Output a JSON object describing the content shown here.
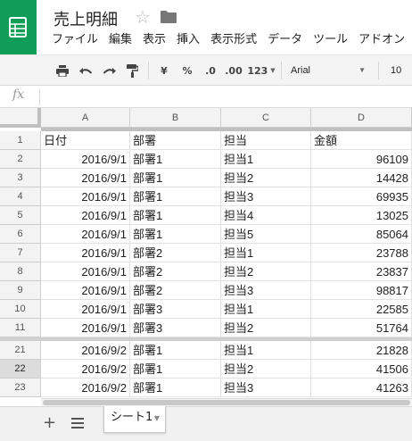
{
  "app": {
    "title": "売上明細",
    "menu": [
      "ファイル",
      "編集",
      "表示",
      "挿入",
      "表示形式",
      "データ",
      "ツール",
      "アドオン"
    ]
  },
  "toolbar": {
    "currency": "¥",
    "percent": "%",
    "decrease_decimal": ".0",
    "increase_decimal": ".00",
    "more_formats": "123",
    "font": "Arial",
    "font_size": "10"
  },
  "formula_bar": {
    "fx": "fx",
    "value": ""
  },
  "grid": {
    "columns": [
      "A",
      "B",
      "C",
      "D"
    ],
    "rows": [
      {
        "num": "1",
        "a": "日付",
        "b": "部署",
        "c": "担当",
        "d": "金額",
        "header": true
      },
      {
        "num": "2",
        "a": "2016/9/1",
        "b": "部署1",
        "c": "担当1",
        "d": "96109"
      },
      {
        "num": "3",
        "a": "2016/9/1",
        "b": "部署1",
        "c": "担当2",
        "d": "14428"
      },
      {
        "num": "4",
        "a": "2016/9/1",
        "b": "部署1",
        "c": "担当3",
        "d": "69935"
      },
      {
        "num": "5",
        "a": "2016/9/1",
        "b": "部署1",
        "c": "担当4",
        "d": "13025"
      },
      {
        "num": "6",
        "a": "2016/9/1",
        "b": "部署1",
        "c": "担当5",
        "d": "85064"
      },
      {
        "num": "7",
        "a": "2016/9/1",
        "b": "部署2",
        "c": "担当1",
        "d": "23788"
      },
      {
        "num": "8",
        "a": "2016/9/1",
        "b": "部署2",
        "c": "担当2",
        "d": "23837"
      },
      {
        "num": "9",
        "a": "2016/9/1",
        "b": "部署2",
        "c": "担当3",
        "d": "98817"
      },
      {
        "num": "10",
        "a": "2016/9/1",
        "b": "部署3",
        "c": "担当1",
        "d": "22585"
      },
      {
        "num": "11",
        "a": "2016/9/1",
        "b": "部署3",
        "c": "担当2",
        "d": "51764"
      },
      {
        "num": "21",
        "a": "2016/9/2",
        "b": "部署1",
        "c": "担当1",
        "d": "21828"
      },
      {
        "num": "22",
        "a": "2016/9/2",
        "b": "部署1",
        "c": "担当2",
        "d": "41506",
        "selected": true
      },
      {
        "num": "23",
        "a": "2016/9/2",
        "b": "部署1",
        "c": "担当3",
        "d": "41263"
      }
    ]
  },
  "sheets": {
    "add": "+",
    "tabs": [
      "シート1"
    ]
  },
  "colors": {
    "brand": "#109d58",
    "toolbar_bg": "#f4f4f4",
    "header_bg": "#f3f3f3"
  },
  "icons": [
    "sheets-logo-icon",
    "star-icon",
    "folder-icon",
    "print-icon",
    "undo-icon",
    "redo-icon",
    "paint-format-icon",
    "add-sheet-icon",
    "sheet-list-icon"
  ]
}
